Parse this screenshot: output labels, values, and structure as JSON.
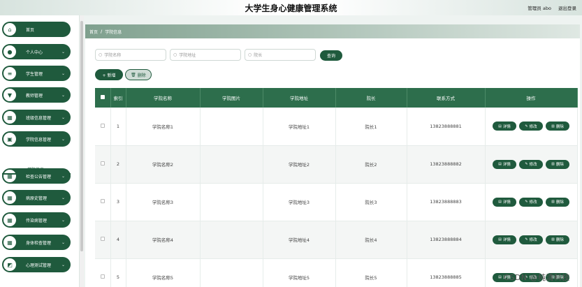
{
  "header": {
    "title": "大学生身心健康管理系统",
    "user_label": "管理员 abo",
    "logout": "退出登录"
  },
  "sidebar": {
    "items": [
      {
        "label": "首页",
        "icon": "home-icon",
        "glyph": "⌂",
        "has_arrow": false
      },
      {
        "label": "个人中心",
        "icon": "user-icon",
        "glyph": "●",
        "has_arrow": true
      },
      {
        "label": "学生管理",
        "icon": "list-icon",
        "glyph": "≡",
        "has_arrow": true
      },
      {
        "label": "教师管理",
        "icon": "shield-icon",
        "glyph": "▼",
        "has_arrow": true
      },
      {
        "label": "班级信息管理",
        "icon": "grid-icon",
        "glyph": "▦",
        "has_arrow": true
      },
      {
        "label": "学院信息管理",
        "icon": "building-icon",
        "glyph": "▣",
        "has_arrow": true
      },
      {
        "label": "检查公告管理",
        "icon": "grid-icon",
        "glyph": "▦",
        "has_arrow": true
      },
      {
        "label": "病原史管理",
        "icon": "grid-icon",
        "glyph": "▦",
        "has_arrow": true
      },
      {
        "label": "传染病管理",
        "icon": "grid-icon",
        "glyph": "▦",
        "has_arrow": true
      },
      {
        "label": "身体检查管理",
        "icon": "grid-icon",
        "glyph": "▦",
        "has_arrow": true
      },
      {
        "label": "心理测试管理",
        "icon": "chart-icon",
        "glyph": "◩",
        "has_arrow": true
      }
    ],
    "submenu": {
      "label": "学院信息"
    },
    "arrow_glyph": "⌄"
  },
  "breadcrumb": {
    "home": "首页",
    "separator": "/",
    "current": "学院信息"
  },
  "search": {
    "college_name_placeholder": "学院名称",
    "college_address_placeholder": "学院地址",
    "dean_placeholder": "院长",
    "search_button": "查询"
  },
  "toolbar": {
    "add_label": "+ 新增",
    "delete_label": "删除"
  },
  "table": {
    "headers": {
      "index": "索引",
      "name": "学院名称",
      "image": "学院图片",
      "address": "学院地址",
      "dean": "院长",
      "contact": "联系方式",
      "actions": "操作"
    },
    "rows": [
      {
        "index": "1",
        "name": "学院名称1",
        "image": "",
        "address": "学院地址1",
        "dean": "院长1",
        "contact": "13823888881"
      },
      {
        "index": "2",
        "name": "学院名称2",
        "image": "",
        "address": "学院地址2",
        "dean": "院长2",
        "contact": "13823888882"
      },
      {
        "index": "3",
        "name": "学院名称3",
        "image": "",
        "address": "学院地址3",
        "dean": "院长3",
        "contact": "13823888883"
      },
      {
        "index": "4",
        "name": "学院名称4",
        "image": "",
        "address": "学院地址4",
        "dean": "院长4",
        "contact": "13823888884"
      },
      {
        "index": "5",
        "name": "学院名称5",
        "image": "",
        "address": "学院地址5",
        "dean": "院长5",
        "contact": "13823888885"
      }
    ],
    "row_actions": {
      "detail": "详情",
      "edit": "修改",
      "delete": "删除"
    }
  },
  "watermark": "CSDN @纯清科技",
  "colors": {
    "primary": "#1f5a3d",
    "table_header": "#2d6e4c",
    "background": "#eef3f1"
  }
}
